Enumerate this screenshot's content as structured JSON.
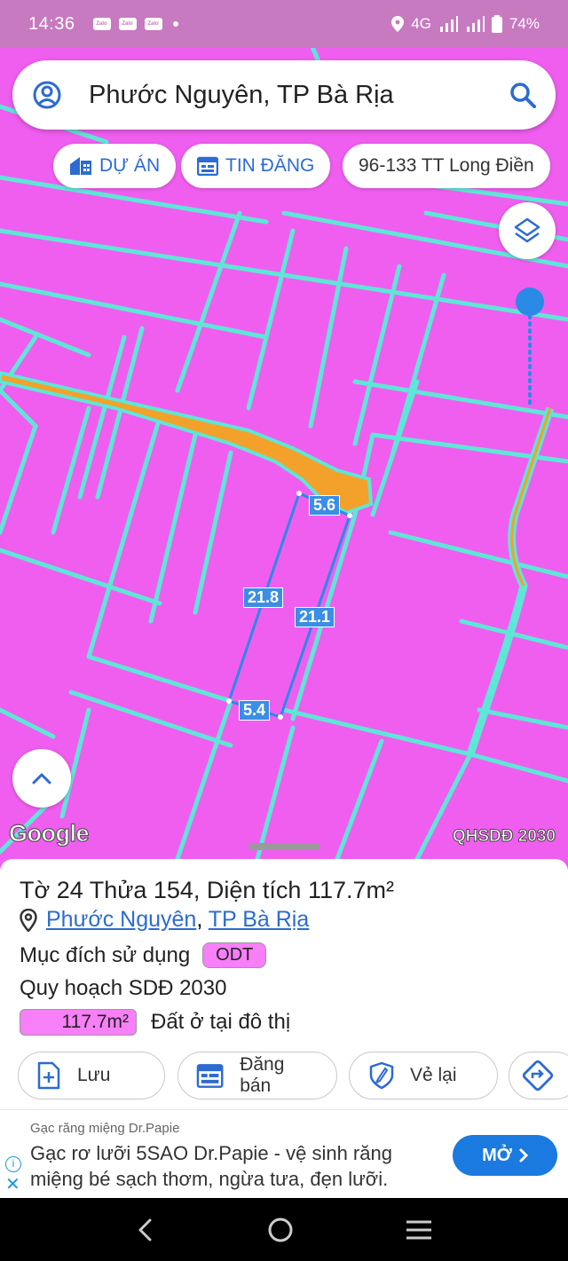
{
  "status_bar": {
    "time": "14:36",
    "notification_apps": [
      "Zalo",
      "Zalo",
      "Zalo"
    ],
    "network": "4G",
    "battery": "74%",
    "icons": [
      "location-icon",
      "signal-icon",
      "signal-icon",
      "battery-icon"
    ]
  },
  "search": {
    "query": "Phước Nguyên, TP Bà Rịa",
    "left_icon": "account-icon",
    "right_icon": "search-icon"
  },
  "chips": [
    {
      "label": "DỰ ÁN",
      "icon": "building-icon"
    },
    {
      "label": "TIN ĐĂNG",
      "icon": "listing-icon"
    },
    {
      "label": "96-133 TT Long Điền",
      "icon": ""
    }
  ],
  "map": {
    "layer_label": "QHSDĐ 2030",
    "google_label": "Google",
    "parcel_edges": [
      "5.6",
      "21.8",
      "21.1",
      "5.4"
    ],
    "colors": {
      "land": "#f05ef0",
      "parcel_lines": "#5ee6d6",
      "road": "#f3a12a",
      "selection": "#2a8ae6"
    },
    "opacity_slider_level": 1.0
  },
  "parcel": {
    "title": "Tờ 24 Thửa 154, Diện tích 117.7m²",
    "ward": "Phước Nguyên",
    "separator": ",",
    "city": "TP Bà Rịa",
    "purpose_label": "Mục đích sử dụng",
    "purpose_code": "ODT",
    "plan_label": "Quy hoạch SDĐ 2030",
    "plan_area": "117.7m²",
    "plan_use": "Đất ở tại đô thị"
  },
  "actions": [
    {
      "label": "Lưu",
      "icon": "save-icon"
    },
    {
      "label": "Đăng bán",
      "icon": "calendar-icon"
    },
    {
      "label": "Vẻ lại",
      "icon": "redraw-icon"
    },
    {
      "label": "",
      "icon": "directions-icon"
    }
  ],
  "ad": {
    "source": "Gạc răng miệng Dr.Papie",
    "text": "Gạc rơ lưỡi 5SAO Dr.Papie - vệ sinh răng miệng bé sạch thơm, ngừa tưa, đẹn lưỡi.",
    "cta": "MỞ"
  },
  "nav": {
    "icons": [
      "back-icon",
      "home-icon",
      "recents-icon"
    ]
  }
}
